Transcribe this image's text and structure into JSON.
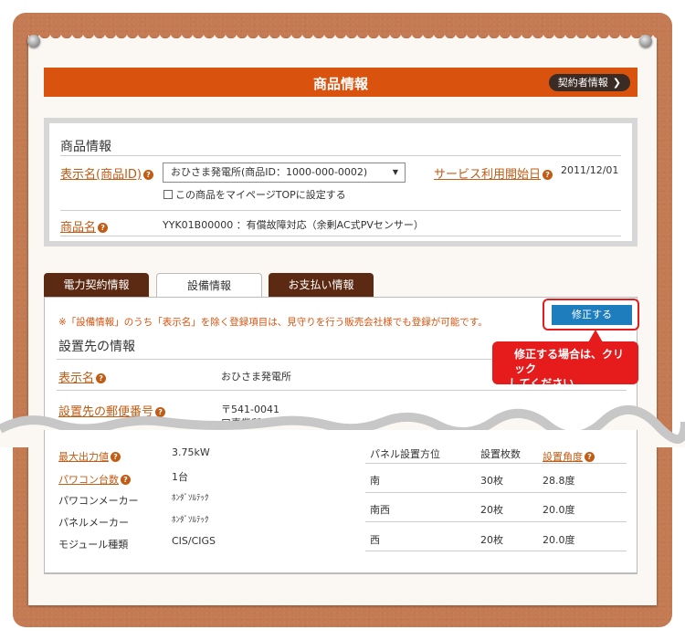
{
  "header": {
    "title": "商品情報",
    "contract_button": "契約者情報"
  },
  "product_info": {
    "section_title": "商品情報",
    "display_name_label": "表示名(商品ID)",
    "display_name_select": "おひさま発電所(商品ID：1000-000-0002)",
    "checkbox_label": "この商品をマイページTOPに設定する",
    "service_start_label": "サービス利用開始日",
    "service_start_value": "2011/12/01",
    "product_name_label": "商品名",
    "product_name_value": "YYK01B00000 ：有償故障対応（余剰AC式PVセンサー）"
  },
  "tabs": [
    {
      "label": "電力契約情報"
    },
    {
      "label": "設備情報"
    },
    {
      "label": "お支払い情報"
    }
  ],
  "equipment": {
    "notice": "※「設備情報」のうち「表示名」を除く登録項目は、見守りを行う販売会社様でも登録が可能です。",
    "edit_button": "修正する",
    "callout_line1": "修正する場合は、クリック",
    "callout_line2": "してください。",
    "section_title": "設置先の情報",
    "display_name_label": "表示名",
    "display_name_value": "おひさま発電所",
    "postal_label": "設置先の郵便番号",
    "postal_value": "〒541-0041",
    "postal_value_partial": "口事業所",
    "max_output_label": "最大出力値",
    "max_output_value": "3.75kW",
    "pcs_count_label": "パワコン台数",
    "pcs_count_value": "1台",
    "pcs_maker_label": "パワコンメーカー",
    "pcs_maker_value": "ﾎﾝﾀﾞｿﾙﾃｯｸ",
    "panel_maker_label": "パネルメーカー",
    "panel_maker_value": "ﾎﾝﾀﾞｿﾙﾃｯｸ",
    "module_label": "モジュール種類",
    "module_value": "CIS/CIGS",
    "panel_table": {
      "headers": [
        "パネル設置方位",
        "設置枚数",
        "設置角度"
      ],
      "rows": [
        [
          "南",
          "30枚",
          "28.8度"
        ],
        [
          "南西",
          "20枚",
          "20.0度"
        ],
        [
          "西",
          "20枚",
          "20.0度"
        ]
      ]
    }
  },
  "colors": {
    "board": "#c47a52",
    "header": "#d9530f",
    "tab_dark": "#5c2a12",
    "edit_button": "#1e7dbd",
    "callout": "#e61b1b",
    "link": "#c25b14"
  }
}
